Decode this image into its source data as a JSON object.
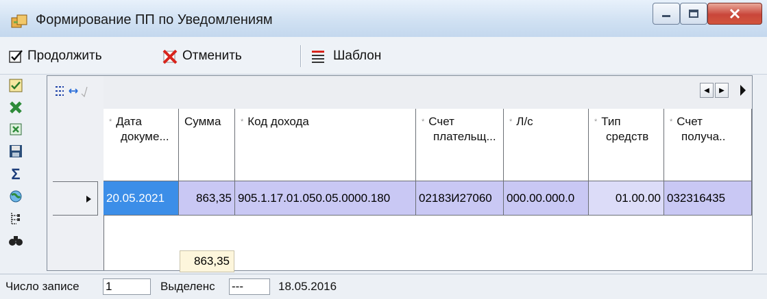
{
  "window": {
    "title": "Формирование ПП по Уведомлениям"
  },
  "toolbar": {
    "continue_label": "Продолжить",
    "cancel_label": "Отменить",
    "template_label": "Шаблон"
  },
  "grid": {
    "columns": [
      {
        "label": "Дата докуме...",
        "line1": "Дата",
        "line2": "докуме...",
        "sortable": true
      },
      {
        "label": "Сумма",
        "line1": "Сумма",
        "line2": "",
        "sortable": false
      },
      {
        "label": "Код дохода",
        "line1": "Код дохода",
        "line2": "",
        "sortable": true
      },
      {
        "label": "Счет плательщ...",
        "line1": "Счет",
        "line2": "плательщ...",
        "sortable": true
      },
      {
        "label": "Л/с",
        "line1": "Л/с",
        "line2": "",
        "sortable": true
      },
      {
        "label": "Тип средств",
        "line1": "Тип",
        "line2": "средств",
        "sortable": true
      },
      {
        "label": "Счет получа..",
        "line1": "Счет",
        "line2": "получа..",
        "sortable": true
      }
    ],
    "row": {
      "date": "20.05.2021",
      "sum": "863,35",
      "income_code": "905.1.17.01.050.05.0000.180",
      "payer_account": "02183И27060",
      "ls": "000.00.000.0",
      "fund_type": "01.00.00",
      "recipient_account": "032316435"
    },
    "total_sum": "863,35"
  },
  "status": {
    "records_label": "Число записе",
    "records_value": "1",
    "selected_label": "Выделенс",
    "selected_value": "---",
    "date": "18.05.2016"
  },
  "colors": {
    "row_selected": "#c9c8f4",
    "date_cell": "#3c8ee8",
    "title_bar": "#cfe0f2",
    "close_button": "#c9463a"
  }
}
